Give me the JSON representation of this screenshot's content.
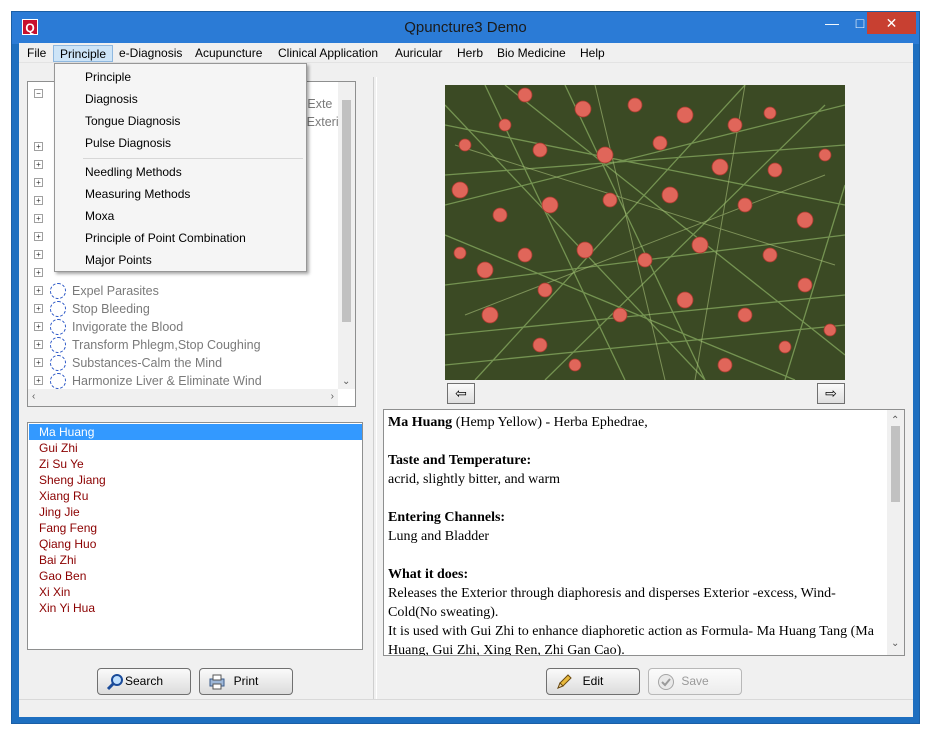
{
  "window": {
    "title": "Qpuncture3 Demo",
    "app_icon_letter": "Q"
  },
  "menu": [
    "File",
    "Principle",
    "e-Diagnosis",
    "Acupuncture",
    "Clinical Application",
    "Auricular",
    "Herb",
    "Bio Medicine",
    "Help"
  ],
  "dropdown": {
    "group1": [
      "Principle",
      "Diagnosis",
      "Tongue Diagnosis",
      "Pulse Diagnosis"
    ],
    "group2": [
      "Needling Methods",
      "Measuring Methods",
      "Moxa",
      "Principle of Point Combination",
      "Major Points"
    ]
  },
  "tree": {
    "partial_right": [
      "ne Exte",
      "se Exteri"
    ],
    "items": [
      "Expel Parasites",
      "Stop Bleeding",
      "Invigorate the Blood",
      "Transform Phlegm,Stop Coughing",
      "Substances-Calm the Mind",
      "Harmonize Liver & Eliminate Wind"
    ]
  },
  "herb_list": {
    "selected": "Ma Huang",
    "items": [
      "Ma Huang",
      "Gui Zhi",
      "Zi Su Ye",
      "Sheng Jiang",
      "Xiang Ru",
      "Jing Jie",
      "Fang Feng",
      "Qiang Huo",
      "Bai Zhi",
      "Gao Ben",
      "Xi Xin",
      "Xin Yi Hua"
    ]
  },
  "nav": {
    "prev": "⇦",
    "next": "⇨"
  },
  "description": {
    "herb_name": "Ma Huang",
    "herb_rest": " (Hemp Yellow) - Herba Ephedrae,",
    "taste_heading": "Taste and Temperature:",
    "taste_text": "acrid, slightly bitter, and warm",
    "channels_heading": "Entering Channels:",
    "channels_text": "Lung and Bladder",
    "action_heading": "What it does:",
    "action_text1": "Releases the Exterior through diaphoresis and disperses Exterior -excess, Wind-Cold(No sweating).",
    "action_text2": "It is used with Gui Zhi to enhance diaphoretic action as  Formula- Ma Huang Tang (Ma Huang, Gui Zhi, Xing Ren, Zhi Gan Cao)."
  },
  "buttons": {
    "search": "Search",
    "print": "Print",
    "edit": "Edit",
    "save": "Save"
  },
  "colors": {
    "titlebar": "#2b7bd6",
    "selection": "#3399ff",
    "herb_text": "#8b0000",
    "close": "#c84031"
  }
}
